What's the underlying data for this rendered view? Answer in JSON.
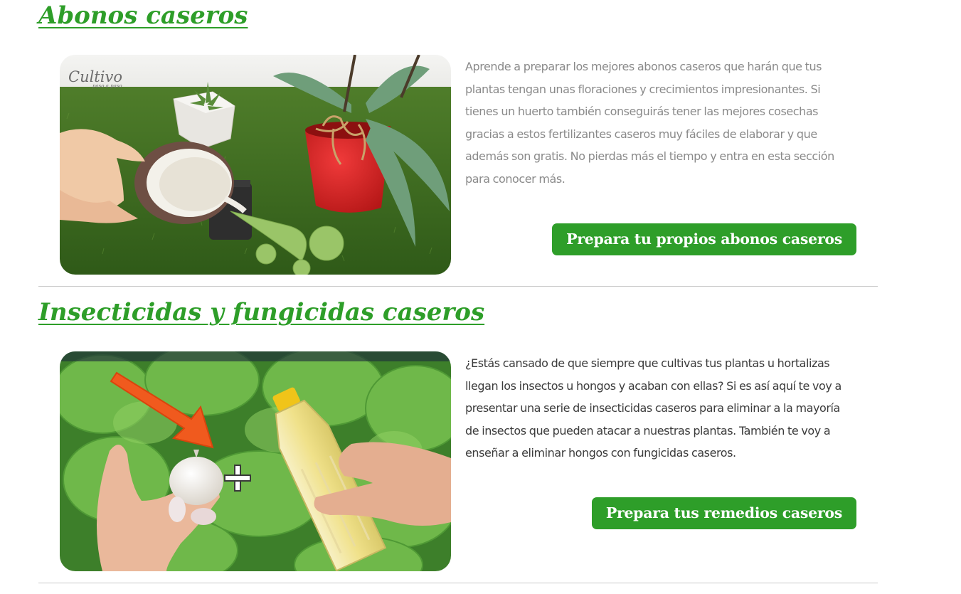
{
  "sections": [
    {
      "title": "Abonos caseros",
      "image": {
        "alt": "Persona vertiendo abono casero sobre plantas",
        "watermark_main": "Cultivo",
        "watermark_sub": "paso a paso"
      },
      "description": "Aprende a preparar los mejores abonos caseros que harán que tus plantas tengan unas floraciones y crecimientos impresionantes. Si tienes un huerto también conseguirás tener las mejores cosechas gracias a estos fertilizantes caseros muy fáciles de elaborar y que además son gratis. No pierdas más el tiempo y entra en esta sección para conocer más.",
      "button_label": "Prepara tu propios abonos caseros"
    },
    {
      "title": "Insecticidas y fungicidas caseros",
      "image": {
        "alt": "Ajo y botella de aceite sobre plantas de lechuga"
      },
      "description": "¿Estás cansado de que siempre que cultivas tus plantas u hortalizas llegan los insectos u hongos y acaban con ellas? Si es así aquí te voy a presentar una serie de insecticidas caseros para eliminar a la mayoría de insectos que pueden atacar a nuestras plantas. También te voy a enseñar a eliminar hongos con fungicidas caseros.",
      "button_label": "Prepara tus remedios caseros"
    }
  ],
  "colors": {
    "accent": "#2e9e29",
    "muted_text": "#8a8a8a",
    "dark_text": "#3b3b3b",
    "divider": "#c9c9c9"
  }
}
